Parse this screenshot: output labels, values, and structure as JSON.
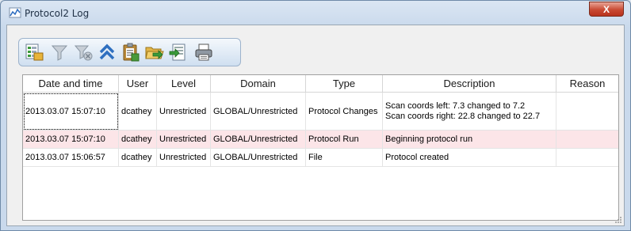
{
  "window": {
    "title": "Protocol2 Log",
    "close_label": "X"
  },
  "toolbar": {
    "buttons": [
      {
        "name": "select-columns-icon"
      },
      {
        "name": "filter-icon"
      },
      {
        "name": "clear-filter-icon"
      },
      {
        "name": "collapse-up-icon"
      },
      {
        "name": "clipboard-icon"
      },
      {
        "name": "open-folder-icon"
      },
      {
        "name": "export-icon"
      },
      {
        "name": "print-icon"
      }
    ]
  },
  "table": {
    "columns": [
      "Date and time",
      "User",
      "Level",
      "Domain",
      "Type",
      "Description",
      "Reason"
    ],
    "rows": [
      {
        "datetime": "2013.03.07 15:07:10",
        "user": "dcathey",
        "level": "Unrestricted",
        "domain": "GLOBAL/Unrestricted",
        "type": "Protocol Changes",
        "description_line1": "Scan coords left: 7.3 changed to 7.2",
        "description_line2": "Scan coords right: 22.8 changed to 22.7",
        "reason": ""
      },
      {
        "datetime": "2013.03.07 15:07:10",
        "user": "dcathey",
        "level": "Unrestricted",
        "domain": "GLOBAL/Unrestricted",
        "type": "Protocol Run",
        "description_line1": "Beginning protocol run",
        "reason": ""
      },
      {
        "datetime": "2013.03.07 15:06:57",
        "user": "dcathey",
        "level": "Unrestricted",
        "domain": "GLOBAL/Unrestricted",
        "type": "File",
        "description_line1": "Protocol created",
        "reason": ""
      }
    ]
  },
  "colors": {
    "highlight_row": "#fce5e8",
    "close_button": "#c94a33",
    "toolbar_bg": "#cfdff0"
  }
}
